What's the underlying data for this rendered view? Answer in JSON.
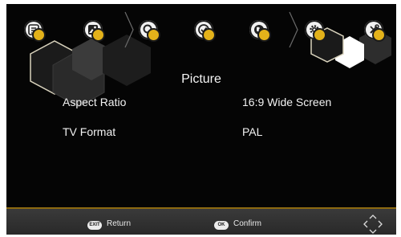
{
  "menu": {
    "tabs": [
      {
        "name": "channel-list",
        "icon": "list-icon"
      },
      {
        "name": "picture",
        "icon": "image-icon"
      },
      {
        "name": "search",
        "icon": "magnifier-icon"
      },
      {
        "name": "time",
        "icon": "clock-check-icon"
      },
      {
        "name": "language",
        "icon": "globe-icon"
      },
      {
        "name": "system",
        "icon": "gear-icon"
      },
      {
        "name": "tools",
        "icon": "tools-icon"
      }
    ],
    "accent_color": "#e3b21a"
  },
  "page": {
    "title": "Picture",
    "rows": [
      {
        "label": "Aspect Ratio",
        "value": "16:9 Wide Screen"
      },
      {
        "label": "TV Format",
        "value": "PAL"
      }
    ]
  },
  "footer": {
    "exit_key": "EXIT",
    "return_label": "Return",
    "ok_key": "OK",
    "confirm_label": "Confirm",
    "nav_icon": "direction-pad-icon"
  }
}
